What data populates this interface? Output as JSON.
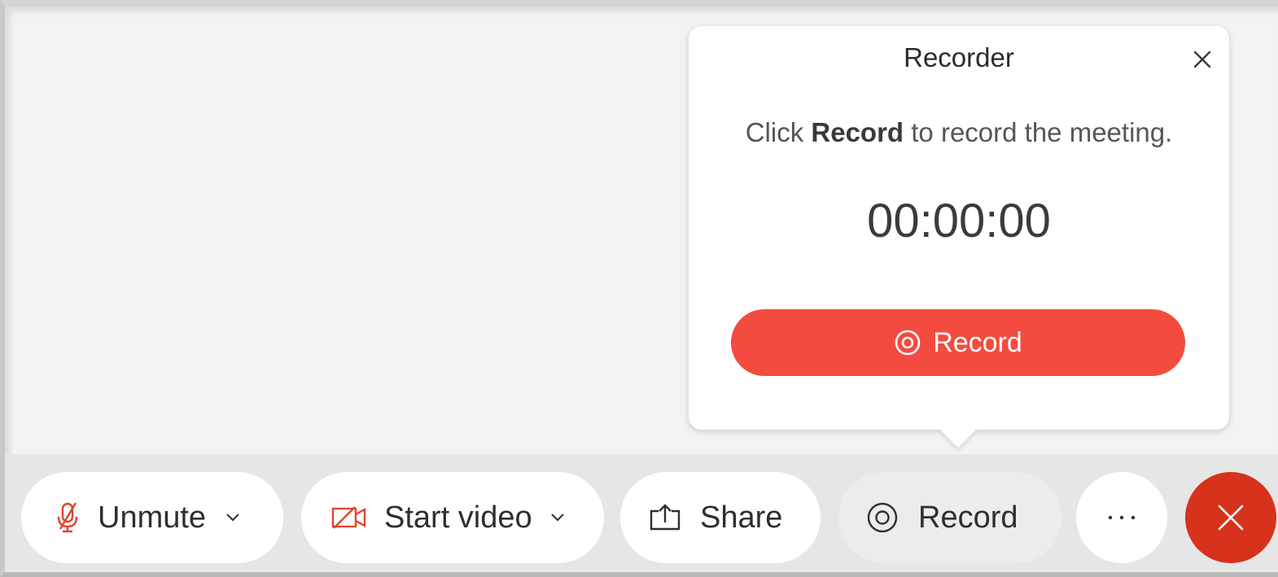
{
  "colors": {
    "accent_red": "#f44b40",
    "leave_red": "#d6321c",
    "icon_red": "#e0452f"
  },
  "popover": {
    "title": "Recorder",
    "message_prefix": "Click ",
    "message_bold": "Record",
    "message_suffix": " to record the meeting.",
    "timer": "00:00:00",
    "record_button_label": "Record",
    "close_icon": "close-icon"
  },
  "toolbar": {
    "unmute_label": "Unmute",
    "start_video_label": "Start video",
    "share_label": "Share",
    "record_label": "Record",
    "more_icon": "ellipsis-icon",
    "leave_icon": "close-icon"
  }
}
